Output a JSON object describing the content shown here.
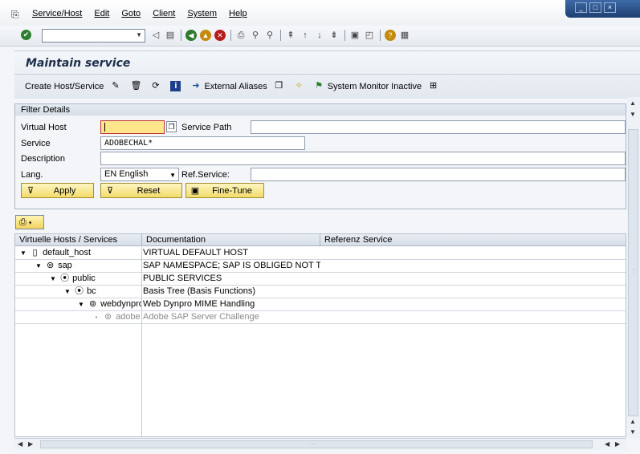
{
  "menu": [
    "Service/Host",
    "Edit",
    "Goto",
    "Client",
    "System",
    "Help"
  ],
  "window_controls": {
    "minimize": "_",
    "maximize": "□",
    "close": "×"
  },
  "toolbar": {
    "command_value": "",
    "icons": [
      "back-icon",
      "save-icon",
      "green-back-icon",
      "yellow-exit-icon",
      "red-cancel-icon",
      "print-icon",
      "find-icon",
      "find-next-icon",
      "first-page-icon",
      "previous-page-icon",
      "next-page-icon",
      "last-page-icon",
      "create-session-icon",
      "shortcut-icon",
      "help-icon",
      "customize-layout-icon"
    ]
  },
  "title": "Maintain service",
  "app_toolbar": {
    "create_host_service": "Create Host/Service",
    "external_aliases": "External Aliases",
    "system_monitor_inactive": "System Monitor Inactive"
  },
  "filter": {
    "header": "Filter Details",
    "virtual_host_label": "Virtual Host",
    "virtual_host_value": "",
    "service_path_label": "Service Path",
    "service_path_value": "",
    "service_label": "Service",
    "service_value": "ADOBECHAL*",
    "description_label": "Description",
    "description_value": "",
    "lang_label": "Lang.",
    "lang_value": "EN English",
    "ref_service_label": "Ref.Service:",
    "ref_service_value": "",
    "apply_button": "Apply",
    "reset_button": "Reset",
    "fine_tune_button": "Fine-Tune"
  },
  "tree": {
    "columns": [
      "Virtuelle Hosts / Services",
      "Documentation",
      "Referenz Service"
    ],
    "rows": [
      {
        "name": "default_host",
        "doc": "VIRTUAL DEFAULT HOST",
        "toggle": "▼",
        "icon": "host-icon"
      },
      {
        "name": "sap",
        "doc": "SAP NAMESPACE; SAP IS OBLIGED NOT T...",
        "toggle": "▼",
        "icon": "service-node-icon"
      },
      {
        "name": "public",
        "doc": "PUBLIC SERVICES",
        "toggle": "▼",
        "icon": "service-node-icon"
      },
      {
        "name": "bc",
        "doc": "Basis Tree (Basis Functions)",
        "toggle": "▼",
        "icon": "service-node-icon"
      },
      {
        "name": "webdynpro",
        "doc": "Web Dynpro MIME Handling",
        "toggle": "▼",
        "icon": "service-node-icon"
      },
      {
        "name": "adobe",
        "doc": "Adobe SAP Server Challenge",
        "toggle": "•",
        "icon": "service-node-icon"
      }
    ]
  }
}
